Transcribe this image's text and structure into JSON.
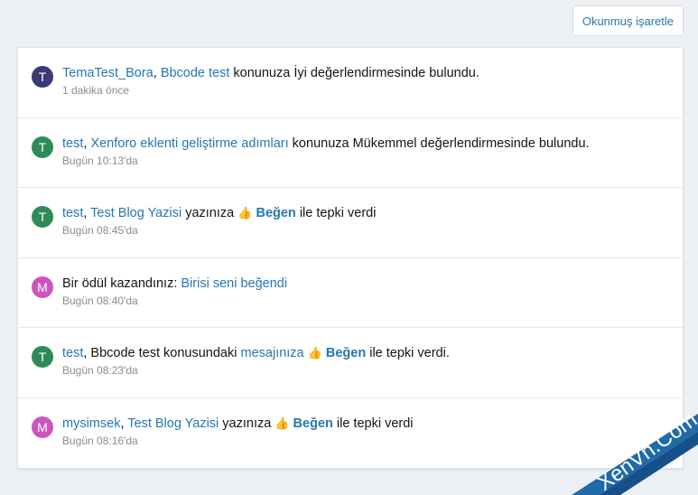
{
  "toolbar": {
    "mark_read_label": "Okunmuş işaretle"
  },
  "colors": {
    "link": "#2577b1",
    "avatar_t_dark": "#3a3a78",
    "avatar_t_green": "#2e8b57",
    "avatar_m": "#cc55bb"
  },
  "notifications": [
    {
      "avatar_letter": "T",
      "avatar_color": "#3a3a78",
      "user": "TemaTest_Bora",
      "sep": ", ",
      "link": "Bbcode test",
      "text": " konunuza İyi değerlendirmesinde bulundu.",
      "time": "1 dakika önce"
    },
    {
      "avatar_letter": "T",
      "avatar_color": "#2e8b57",
      "user": "test",
      "sep": ", ",
      "link": "Xenforo eklenti geliştirme adımları",
      "text": " konunuza Mükemmel değerlendirmesinde bulundu.",
      "time": "Bugün 10:13'da"
    },
    {
      "avatar_letter": "T",
      "avatar_color": "#2e8b57",
      "user": "test",
      "sep": ", ",
      "link": "Test Blog Yazisi",
      "text_before": " yazınıza ",
      "emoji": "👍",
      "reaction": "Beğen",
      "text_after": " ile tepki verdi",
      "time": "Bugün 08:45'da"
    },
    {
      "avatar_letter": "M",
      "avatar_color": "#cc55bb",
      "text_before": "Bir ödül kazandınız: ",
      "link": "Birisi seni beğendi",
      "time": "Bugün 08:40'da"
    },
    {
      "avatar_letter": "T",
      "avatar_color": "#2e8b57",
      "user": "test",
      "text_mid": ", Bbcode test konusundaki ",
      "link": "mesajınıza",
      "emoji": "👍",
      "reaction": "Beğen",
      "text_after": " ile tepki verdi.",
      "time": "Bugün 08:23'da"
    },
    {
      "avatar_letter": "M",
      "avatar_color": "#cc55bb",
      "user": "mysimsek",
      "sep": ", ",
      "link": "Test Blog Yazisi",
      "text_before": " yazınıza ",
      "emoji": "👍",
      "reaction": "Beğen",
      "text_after": " ile tepki verdi",
      "time": "Bugün 08:16'da"
    }
  ],
  "watermark": {
    "text": "XenVn.Com"
  }
}
